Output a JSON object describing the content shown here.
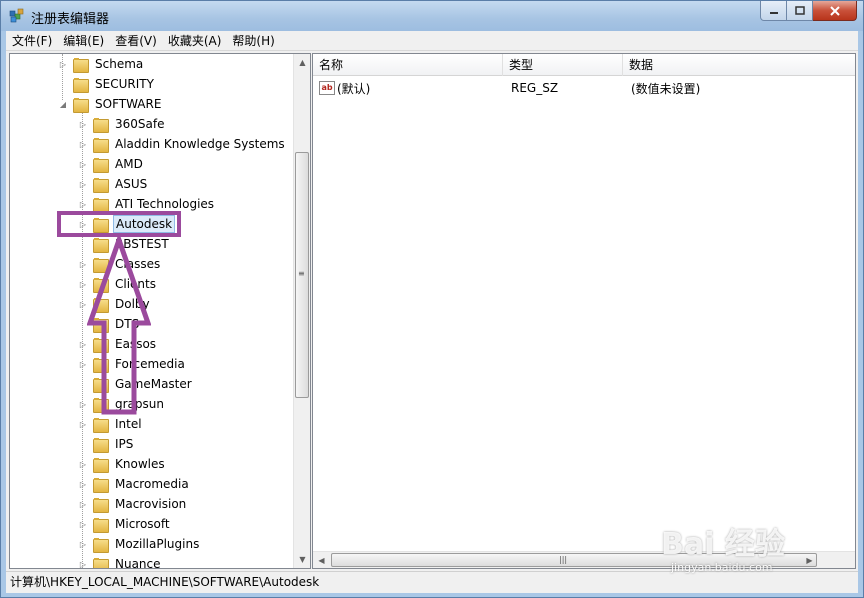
{
  "window": {
    "title": "注册表编辑器"
  },
  "menu": [
    "文件(F)",
    "编辑(E)",
    "查看(V)",
    "收藏夹(A)",
    "帮助(H)"
  ],
  "tree": {
    "items": [
      {
        "label": "Schema",
        "level": 1,
        "expandable": true
      },
      {
        "label": "SECURITY",
        "level": 1,
        "expandable": false
      },
      {
        "label": "SOFTWARE",
        "level": 1,
        "expandable": true,
        "expanded": true
      },
      {
        "label": "360Safe",
        "level": 2,
        "expandable": true
      },
      {
        "label": "Aladdin Knowledge Systems",
        "level": 2,
        "expandable": true
      },
      {
        "label": "AMD",
        "level": 2,
        "expandable": true
      },
      {
        "label": "ASUS",
        "level": 2,
        "expandable": true
      },
      {
        "label": "ATI Technologies",
        "level": 2,
        "expandable": true
      },
      {
        "label": "Autodesk",
        "level": 2,
        "expandable": true,
        "selected": true
      },
      {
        "label": "BBSTEST",
        "level": 2,
        "expandable": false
      },
      {
        "label": "Classes",
        "level": 2,
        "expandable": true
      },
      {
        "label": "Clients",
        "level": 2,
        "expandable": true
      },
      {
        "label": "Dolby",
        "level": 2,
        "expandable": true
      },
      {
        "label": "DTS",
        "level": 2,
        "expandable": false
      },
      {
        "label": "Eassos",
        "level": 2,
        "expandable": true
      },
      {
        "label": "Forcemedia",
        "level": 2,
        "expandable": true
      },
      {
        "label": "GameMaster",
        "level": 2,
        "expandable": false
      },
      {
        "label": "grapsun",
        "level": 2,
        "expandable": true
      },
      {
        "label": "Intel",
        "level": 2,
        "expandable": true
      },
      {
        "label": "IPS",
        "level": 2,
        "expandable": false
      },
      {
        "label": "Knowles",
        "level": 2,
        "expandable": true
      },
      {
        "label": "Macromedia",
        "level": 2,
        "expandable": true
      },
      {
        "label": "Macrovision",
        "level": 2,
        "expandable": true
      },
      {
        "label": "Microsoft",
        "level": 2,
        "expandable": true
      },
      {
        "label": "MozillaPlugins",
        "level": 2,
        "expandable": true
      },
      {
        "label": "Nuance",
        "level": 2,
        "expandable": true
      }
    ]
  },
  "list": {
    "columns": [
      "名称",
      "类型",
      "数据"
    ],
    "rows": [
      {
        "name": "(默认)",
        "type": "REG_SZ",
        "data": "(数值未设置)"
      }
    ]
  },
  "status": "计算机\\HKEY_LOCAL_MACHINE\\SOFTWARE\\Autodesk",
  "watermark": {
    "brand": "Bai 经验",
    "url": "jingyan.baidu.com"
  },
  "colors": {
    "annotation": "#9b4a9d",
    "selection": "#dbeaf9"
  }
}
